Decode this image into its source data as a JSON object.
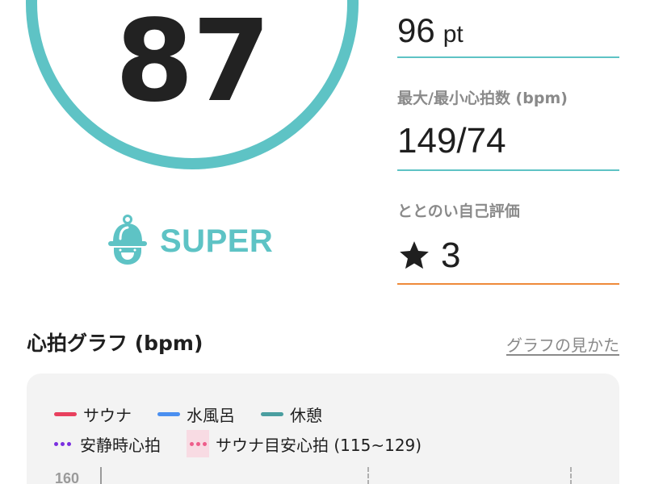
{
  "score": {
    "value": "87",
    "ring_color": "#5ec3c5"
  },
  "rank": {
    "label": "SUPER",
    "icon": "bell-mascot-icon",
    "color": "#5ec3c5"
  },
  "stats": {
    "points": {
      "value": "96",
      "unit": "pt"
    },
    "heart_rate": {
      "label": "最大/最小心拍数 (bpm)",
      "value": "149/74"
    },
    "self_rating": {
      "label": "ととのい自己評価",
      "icon": "star-icon",
      "value": "3"
    },
    "divider_color": "#5ec3c5",
    "rating_divider_color": "#ee8a3a"
  },
  "heart_graph": {
    "title": "心拍グラフ (bpm)",
    "help_link": "グラフの見かた",
    "legend": {
      "sauna": {
        "label": "サウナ",
        "color": "#e8405e"
      },
      "cold_bath": {
        "label": "水風呂",
        "color": "#4a8ff0"
      },
      "rest": {
        "label": "休憩",
        "color": "#4a9ea0"
      },
      "resting_hr": {
        "label": "安静時心拍",
        "color": "#7a2fe0"
      },
      "sauna_target": {
        "label": "サウナ目安心拍 (115~129)",
        "color": "#ee5c8a",
        "zone_color": "#f8dbe3"
      }
    },
    "y_ticks": [
      "160"
    ]
  }
}
